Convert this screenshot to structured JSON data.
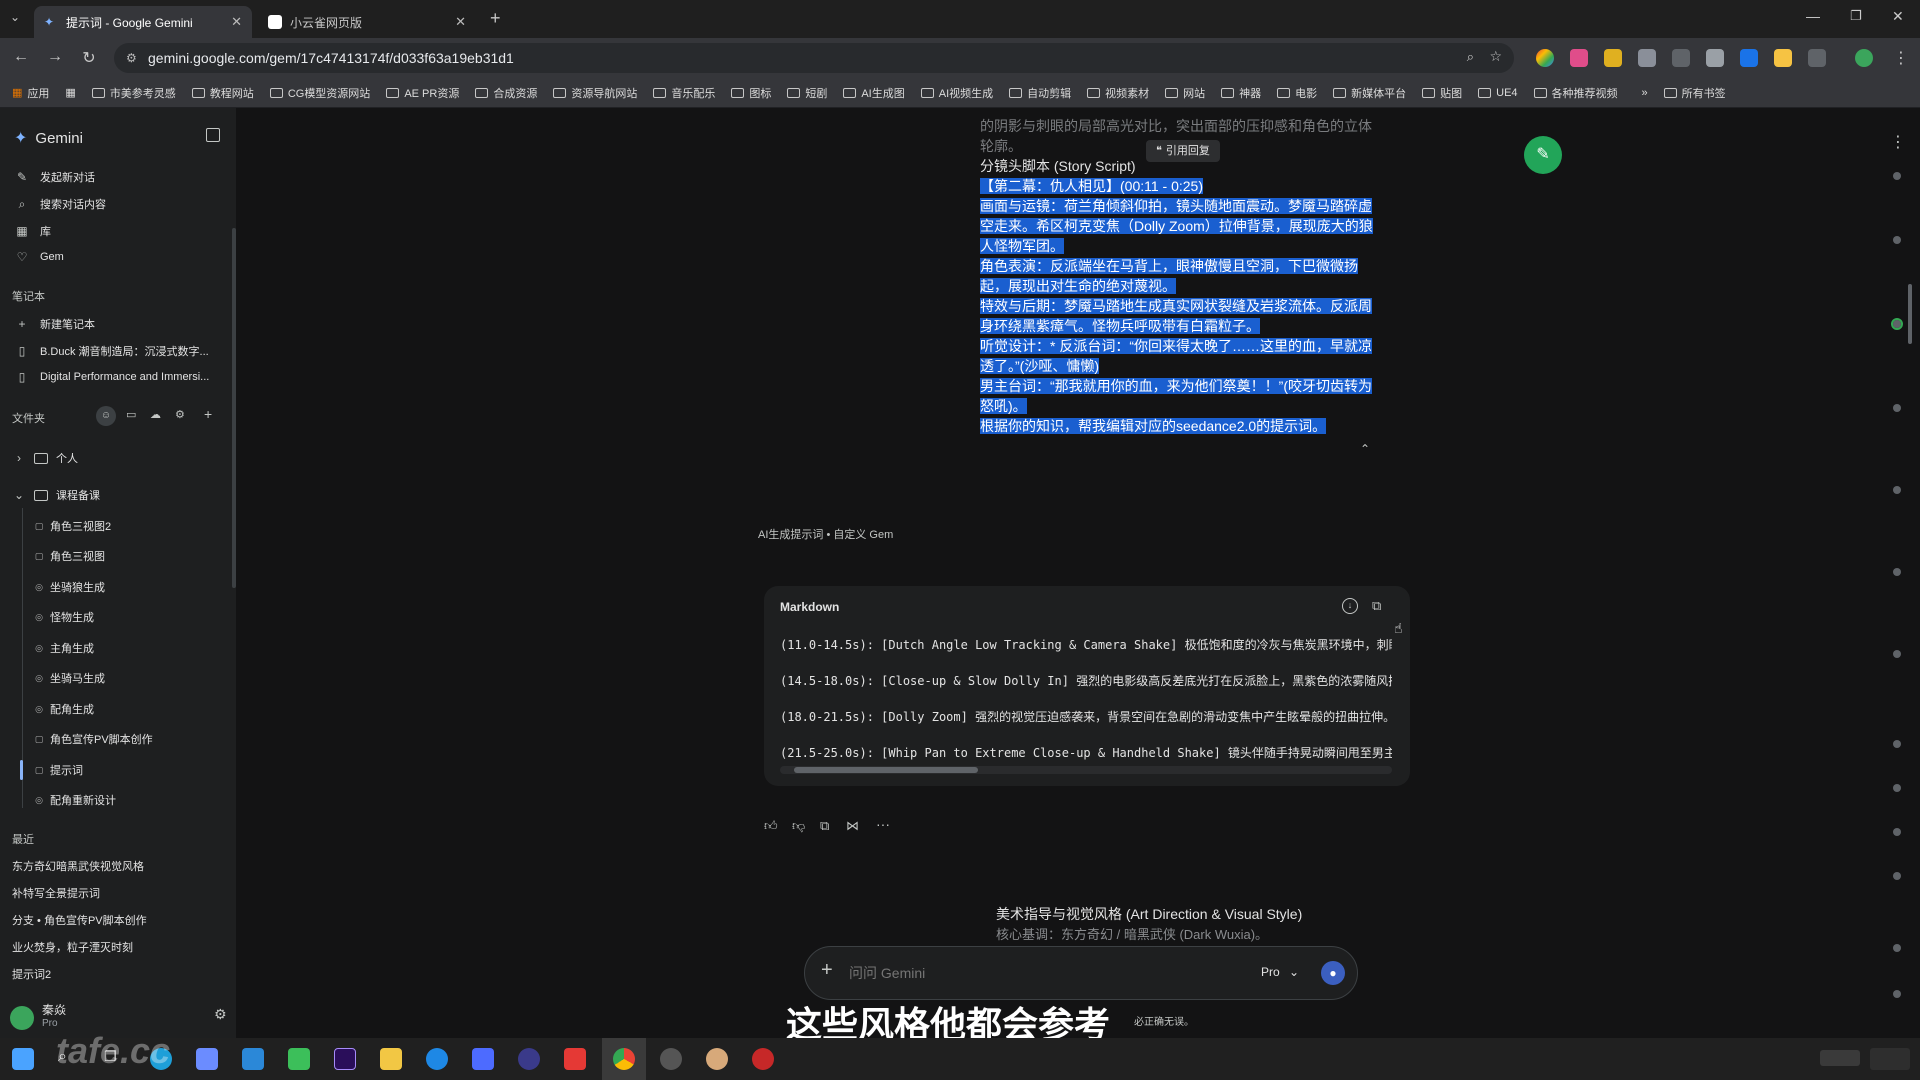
{
  "browser": {
    "tabs": [
      {
        "title": "提示词 - Google Gemini",
        "active": true
      },
      {
        "title": "小云雀网页版",
        "active": false
      }
    ],
    "url": "gemini.google.com/gem/17c47413174f/d033f63a19eb31d1",
    "bookmarks": [
      "应用",
      "市美参考灵感",
      "教程网站",
      "CG模型资源网站",
      "AE PR资源",
      "合成资源",
      "资源导航网站",
      "音乐配乐",
      "图标",
      "短剧",
      "AI生成图",
      "AI视频生成",
      "自动剪辑",
      "视频素材",
      "网站",
      "神器",
      "电影",
      "新媒体平台",
      "贴图",
      "UE4",
      "各种推荐视频",
      "所有书签"
    ]
  },
  "sidebar": {
    "app_name": "Gemini",
    "nav": [
      {
        "label": "发起新对话",
        "icon": "edit-icon"
      },
      {
        "label": "搜索对话内容",
        "icon": "search-icon"
      },
      {
        "label": "库",
        "icon": "library-icon"
      },
      {
        "label": "Gem",
        "icon": "gem-icon"
      }
    ],
    "notebook_label": "笔记本",
    "notebooks": [
      {
        "label": "新建笔记本",
        "icon": "plus-icon"
      },
      {
        "label": "B.Duck 潮音制造局：沉浸式数字...",
        "icon": "notebook-icon"
      },
      {
        "label": "Digital Performance and Immersi...",
        "icon": "notebook-icon"
      }
    ],
    "folder_label": "文件夹",
    "folders": [
      {
        "label": "个人",
        "expanded": false
      },
      {
        "label": "课程备课",
        "expanded": true
      }
    ],
    "folder_items": [
      {
        "label": "角色三视图2",
        "icon": "chat"
      },
      {
        "label": "角色三视图",
        "icon": "chat"
      },
      {
        "label": "坐骑狼生成",
        "icon": "gem"
      },
      {
        "label": "怪物生成",
        "icon": "gem"
      },
      {
        "label": "主角生成",
        "icon": "gem"
      },
      {
        "label": "坐骑马生成",
        "icon": "gem"
      },
      {
        "label": "配角生成",
        "icon": "gem"
      },
      {
        "label": "角色宣传PV脚本创作",
        "icon": "chat"
      },
      {
        "label": "提示词",
        "icon": "chat",
        "active": true
      },
      {
        "label": "配角重新设计",
        "icon": "gem"
      }
    ],
    "recent_label": "最近",
    "recent": [
      "东方奇幻暗黑武侠视觉风格",
      "补特写全景提示词",
      "分支 • 角色宣传PV脚本创作",
      "业火焚身，粒子湮灭时刻",
      "提示词2"
    ],
    "user": {
      "name": "秦焱",
      "plan": "Pro"
    }
  },
  "chat": {
    "user_message": {
      "faded_top": "的阴影与刺眼的局部高光对比，突出面部的压抑感和角色的立体轮廓。",
      "quote_button": "引用回复",
      "line_plain": "分镜头脚本 (Story Script)",
      "highlighted": [
        "【第二幕：仇人相见】(00:11 - 0:25)",
        "画面与运镜：荷兰角倾斜仰拍，镜头随地面震动。梦魇马踏碎虚空走来。希区柯克变焦（Dolly Zoom）拉伸背景，展现庞大的狼人怪物军团。",
        "角色表演：反派端坐在马背上，眼神傲慢且空洞，下巴微微扬起，展现出对生命的绝对蔑视。",
        "特效与后期：梦魇马踏地生成真实网状裂缝及岩浆流体。反派周身环绕黑紫瘴气。怪物兵呼吸带有白霜粒子。",
        "听觉设计：* 反派台词：“你回来得太晚了……这里的血，早就凉透了。”(沙哑、慵懒)",
        "男主台词：“那我就用你的血，来为他们祭奠！！”(咬牙切齿转为怒吼)。",
        "根据你的知识，帮我编辑对应的seedance2.0的提示词。"
      ]
    },
    "response_source": "AI生成提示词 • 自定义 Gem",
    "code_block": {
      "language": "Markdown",
      "lines": [
        "(11.0-14.5s): [Dutch Angle Low Tracking & Camera Shake] 极低饱和度的冷灰与焦炭黑环境中，刺眼的",
        "(14.5-18.0s): [Close-up & Slow Dolly In] 强烈的电影级高反差底光打在反派脸上，黑紫色的浓雾随风拂过",
        "(18.0-21.5s): [Dolly Zoom] 强烈的视觉压迫感袭来，背景空间在急剧的滑动变焦中产生眩晕般的扭曲拉伸。",
        "(21.5-25.0s): [Whip Pan to Extreme Close-up & Handheld Shake] 镜头伴随手持晃动瞬间甩至男主面前"
      ]
    },
    "next_heading": "美术指导与视觉风格 (Art Direction & Visual Style)",
    "next_line": "核心基调：东方奇幻 / 暗黑武侠 (Dark Wuxia)。",
    "input_placeholder": "问问 Gemini",
    "model_label": "Pro",
    "disclaimer_fragment": "必正确无误。"
  },
  "subtitle": "这些风格他都会参考",
  "watermark": "tafe.cc"
}
